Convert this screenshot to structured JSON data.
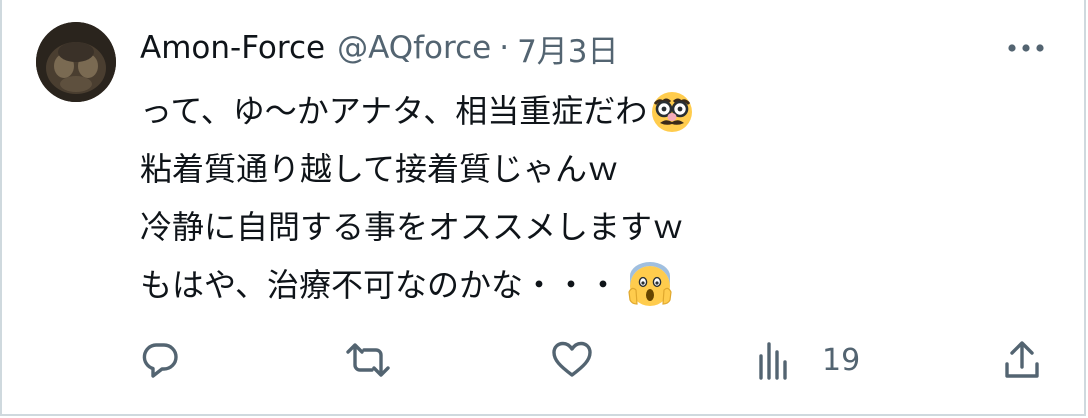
{
  "tweet": {
    "display_name": "Amon-Force",
    "handle": "@AQforce",
    "separator": "·",
    "date": "7月3日",
    "lines": [
      "って、ゆ〜かアナタ、相当重症だわ",
      "粘着質通り越して接着質じゃんｗ",
      "冷静に自問する事をオススメしますｗ",
      "もはや、治療不可なのかな・・・"
    ],
    "emojis": [
      "disguised-face-emoji",
      "screaming-face-emoji"
    ]
  },
  "actions": {
    "reply_icon": "reply-icon",
    "retweet_icon": "retweet-icon",
    "like_icon": "like-icon",
    "views_icon": "views-icon",
    "views_count": "19",
    "share_icon": "share-icon"
  },
  "colors": {
    "text": "#0f1419",
    "secondary": "#536471",
    "border": "#cfd9de",
    "emoji_yellow": "#ffcc4d"
  }
}
